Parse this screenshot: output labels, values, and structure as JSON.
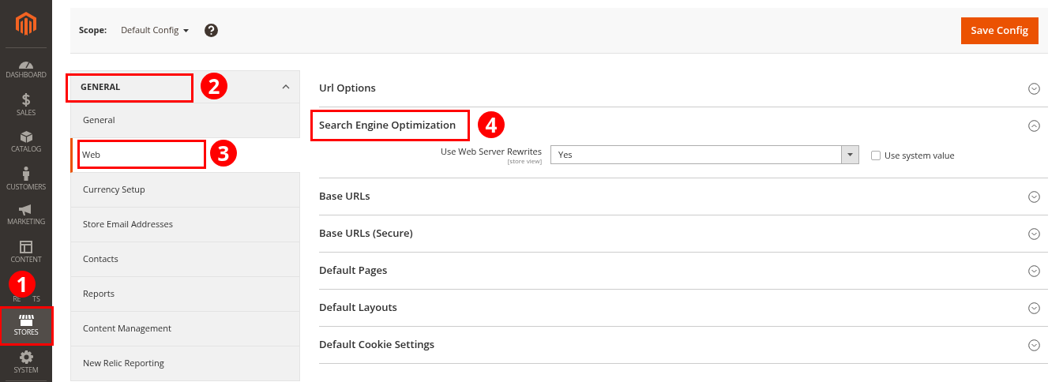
{
  "nav": [
    {
      "label": "DASHBOARD",
      "selected": false
    },
    {
      "label": "SALES",
      "selected": false
    },
    {
      "label": "CATALOG",
      "selected": false
    },
    {
      "label": "CUSTOMERS",
      "selected": false
    },
    {
      "label": "MARKETING",
      "selected": false
    },
    {
      "label": "CONTENT",
      "selected": false
    },
    {
      "label_parts": [
        "RE",
        "TS"
      ]
    },
    {
      "label": "STORES",
      "selected": true
    },
    {
      "label": "SYSTEM",
      "selected": false
    }
  ],
  "scope": {
    "label": "Scope:",
    "value": "Default Config"
  },
  "save_button": "Save Config",
  "tab_group": {
    "title": "GENERAL",
    "expanded": true,
    "items": [
      {
        "label": "General",
        "selected": false
      },
      {
        "label": "Web",
        "selected": true
      },
      {
        "label": "Currency Setup",
        "selected": false
      },
      {
        "label": "Store Email Addresses",
        "selected": false
      },
      {
        "label": "Contacts",
        "selected": false
      },
      {
        "label": "Reports",
        "selected": false
      },
      {
        "label": "Content Management",
        "selected": false
      },
      {
        "label": "New Relic Reporting",
        "selected": false
      }
    ]
  },
  "sections": [
    {
      "title": "Url Options",
      "expanded": false
    },
    {
      "title": "Search Engine Optimization",
      "expanded": true,
      "fields": [
        {
          "label": "Use Web Server Rewrites",
          "scope": "[store view]",
          "value": "Yes",
          "use_system_value": false,
          "system_label": "Use system value"
        }
      ]
    },
    {
      "title": "Base URLs",
      "expanded": false
    },
    {
      "title": "Base URLs (Secure)",
      "expanded": false
    },
    {
      "title": "Default Pages",
      "expanded": false
    },
    {
      "title": "Default Layouts",
      "expanded": false
    },
    {
      "title": "Default Cookie Settings",
      "expanded": false
    }
  ],
  "annotations": [
    {
      "number": "1"
    },
    {
      "number": "2"
    },
    {
      "number": "3"
    },
    {
      "number": "4"
    }
  ]
}
